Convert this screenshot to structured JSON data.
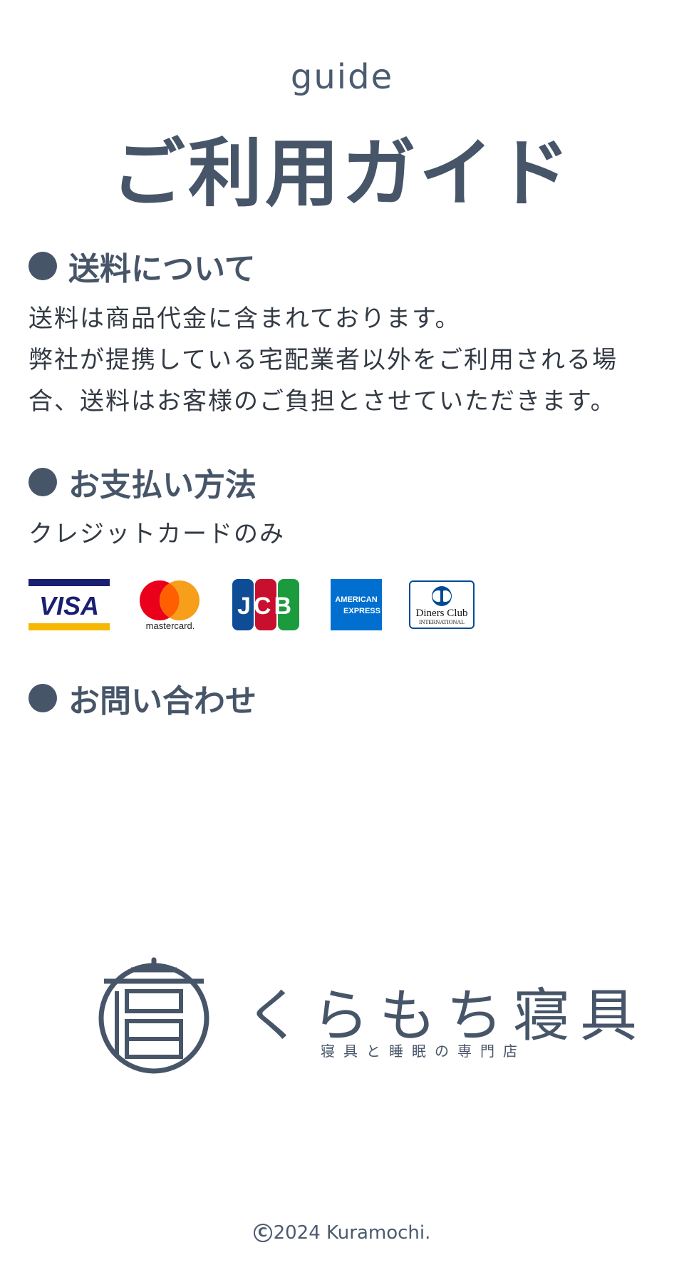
{
  "header": {
    "eyebrow": "guide",
    "title": "ご利用ガイド"
  },
  "sections": {
    "shipping": {
      "heading": "送料について",
      "lines": [
        "送料は商品代金に含まれております。",
        "弊社が提携している宅配業者以外をご利用される場",
        "合、送料はお客様のご負担とさせていただきます。"
      ]
    },
    "payment": {
      "heading": "お支払い方法",
      "text": "クレジットカードのみ",
      "cards": [
        {
          "name": "VISA",
          "icon": "visa-icon"
        },
        {
          "name": "mastercard.",
          "icon": "mastercard-icon"
        },
        {
          "name": "JCB",
          "icon": "jcb-icon"
        },
        {
          "name": "AMERICAN EXPRESS",
          "icon": "amex-icon"
        },
        {
          "name": "Diners Club INTERNATIONAL",
          "icon": "diners-club-icon"
        }
      ]
    },
    "contact": {
      "heading": "お問い合わせ"
    }
  },
  "brand": {
    "name": "くらもち寝具",
    "tagline": "寝具と睡眠の専門店"
  },
  "footer": {
    "copyright_symbol": "C",
    "text": "2024 Kuramochi."
  },
  "colors": {
    "primary": "#475569",
    "text": "#333a44",
    "visa_blue": "#1a1f71",
    "visa_gold": "#f7b600",
    "mastercard_red": "#eb001b",
    "mastercard_orange": "#f79e1b",
    "amex_blue": "#016fd0",
    "diners_blue": "#004a97"
  }
}
